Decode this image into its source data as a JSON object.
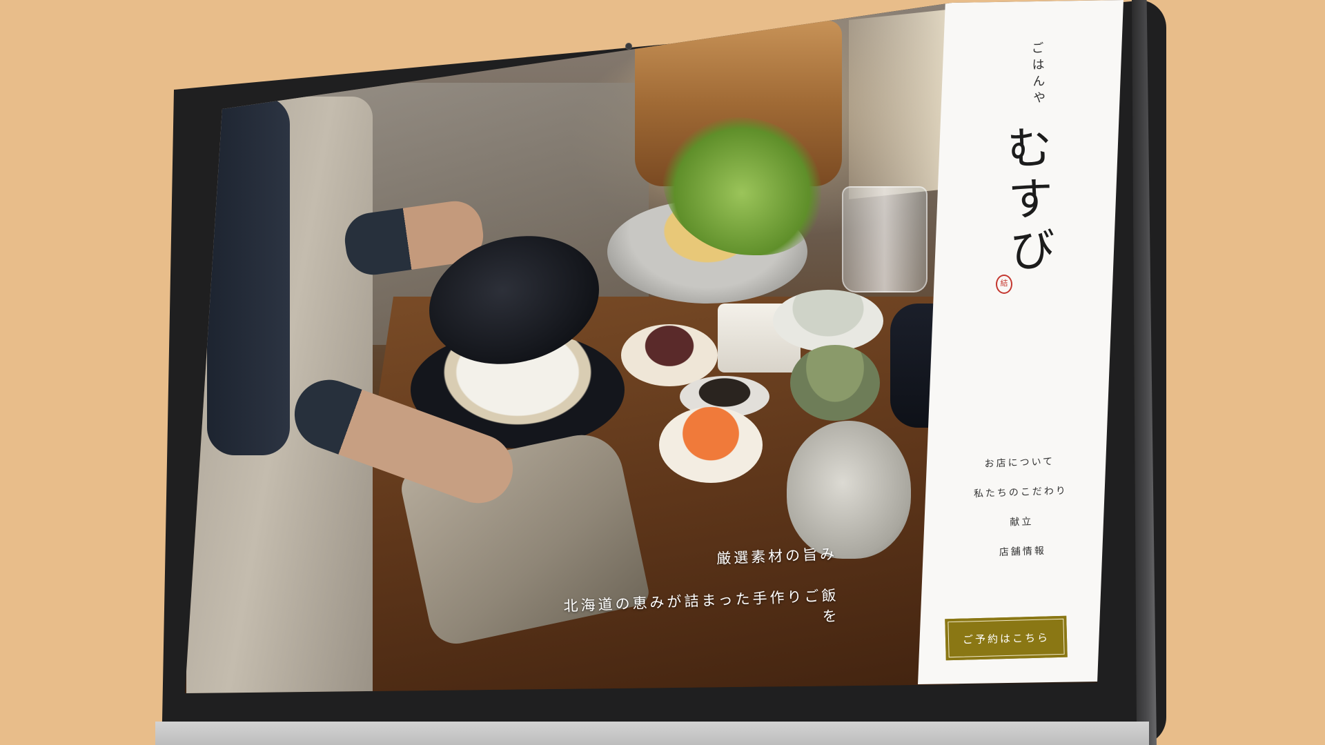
{
  "site": {
    "brand_small": "ごはんや",
    "brand_main": "むすび",
    "seal_char": "結"
  },
  "hero": {
    "catch": "厳選素材の旨み",
    "sub": "北海道の恵みが詰まった手作りご飯を"
  },
  "nav": {
    "items": [
      {
        "label": "お店について"
      },
      {
        "label": "私たちのこだわり"
      },
      {
        "label": "献立"
      },
      {
        "label": "店舗情報"
      }
    ]
  },
  "cta": {
    "label": "ご予約はこちら"
  },
  "colors": {
    "background": "#e8bd8a",
    "cta": "#8a7714",
    "seal": "#c4362e",
    "sidebar": "#f9f8f6"
  }
}
